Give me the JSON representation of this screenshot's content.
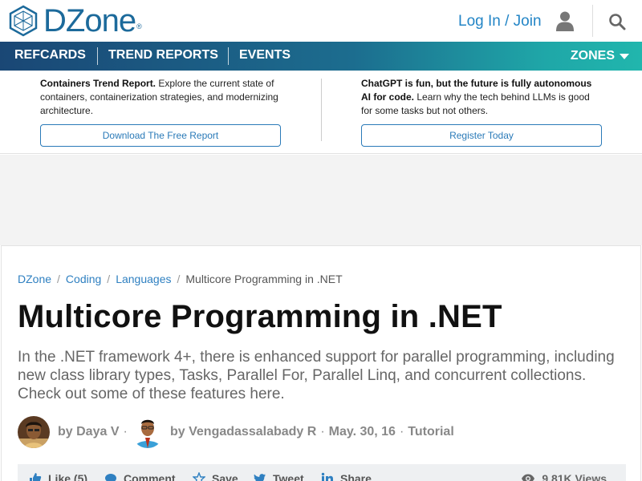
{
  "header": {
    "logo_text": "DZone",
    "logo_reg": "®",
    "login_label": "Log In / Join",
    "user_icon": "user-icon",
    "search_icon": "search-icon"
  },
  "nav": {
    "items": [
      {
        "label": "REFCARDS"
      },
      {
        "label": "TREND REPORTS"
      },
      {
        "label": "EVENTS"
      }
    ],
    "zones_label": "ZONES"
  },
  "promo": {
    "left": {
      "bold": "Containers Trend Report.",
      "text": " Explore the current state of containers, containerization strategies, and modernizing architecture.",
      "button": "Download The Free Report"
    },
    "right": {
      "bold": "ChatGPT is fun, but the future is fully autonomous AI for code.",
      "text": " Learn why the tech behind LLMs is good for some tasks but not others.",
      "button": "Register Today"
    }
  },
  "article": {
    "breadcrumb": [
      "DZone",
      "Coding",
      "Languages",
      "Multicore Programming in .NET"
    ],
    "title": "Multicore Programming in .NET",
    "summary": "In the .NET framework 4+, there is enhanced support for parallel programming, including new class library types, Tasks, Parallel For, Parallel Linq, and concurrent collections. Check out some of these features here.",
    "author1": "by Daya V",
    "author2": "by Vengadassalabady R",
    "date": "May. 30, 16",
    "type": "Tutorial"
  },
  "actions": {
    "like": "Like (5)",
    "comment": "Comment",
    "save": "Save",
    "tweet": "Tweet",
    "share": "Share",
    "views": "9.81K Views"
  },
  "colors": {
    "brand": "#1c6a9b",
    "link": "#2385c6",
    "nav_start": "#1a4775",
    "nav_end": "#21b6ad"
  }
}
